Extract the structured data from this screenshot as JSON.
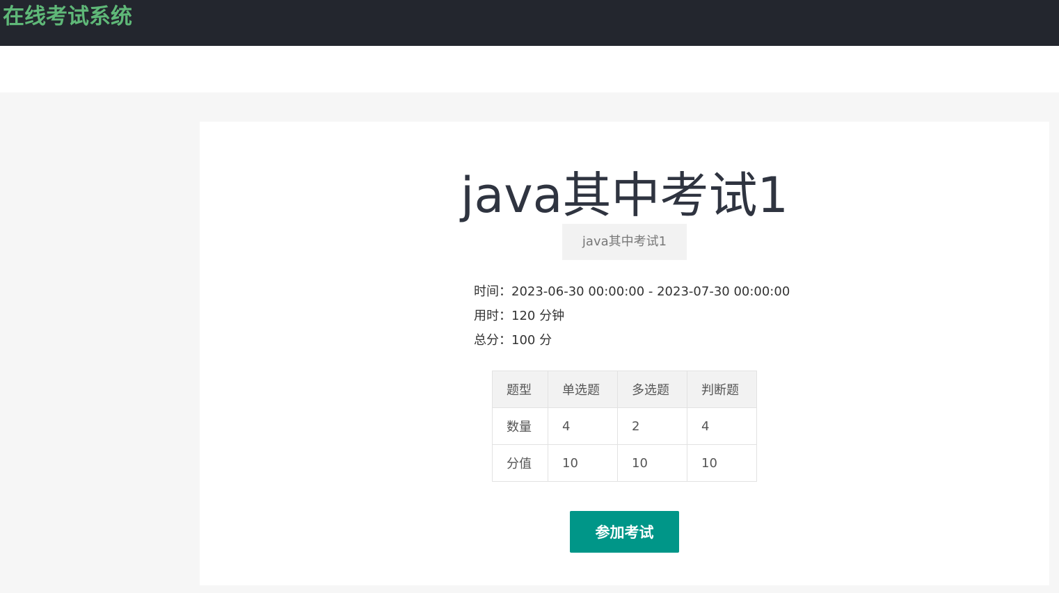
{
  "header": {
    "app_title": "在线考试系统",
    "colors": {
      "bar": "#23262e",
      "logo": "#5fb878"
    }
  },
  "exam": {
    "title": "java其中考试1",
    "subtitle": "java其中考试1",
    "info": {
      "time_label": "时间：",
      "time_value": "2023-06-30 00:00:00 - 2023-07-30 00:00:00",
      "duration_label": "用时：",
      "duration_value": "120 分钟",
      "total_label": "总分：",
      "total_value": "100 分"
    },
    "table": {
      "headers": [
        "题型",
        "单选题",
        "多选题",
        "判断题"
      ],
      "rows": [
        [
          "数量",
          "4",
          "2",
          "4"
        ],
        [
          "分值",
          "10",
          "10",
          "10"
        ]
      ]
    },
    "start_button_label": "参加考试",
    "accent_color": "#009688"
  }
}
